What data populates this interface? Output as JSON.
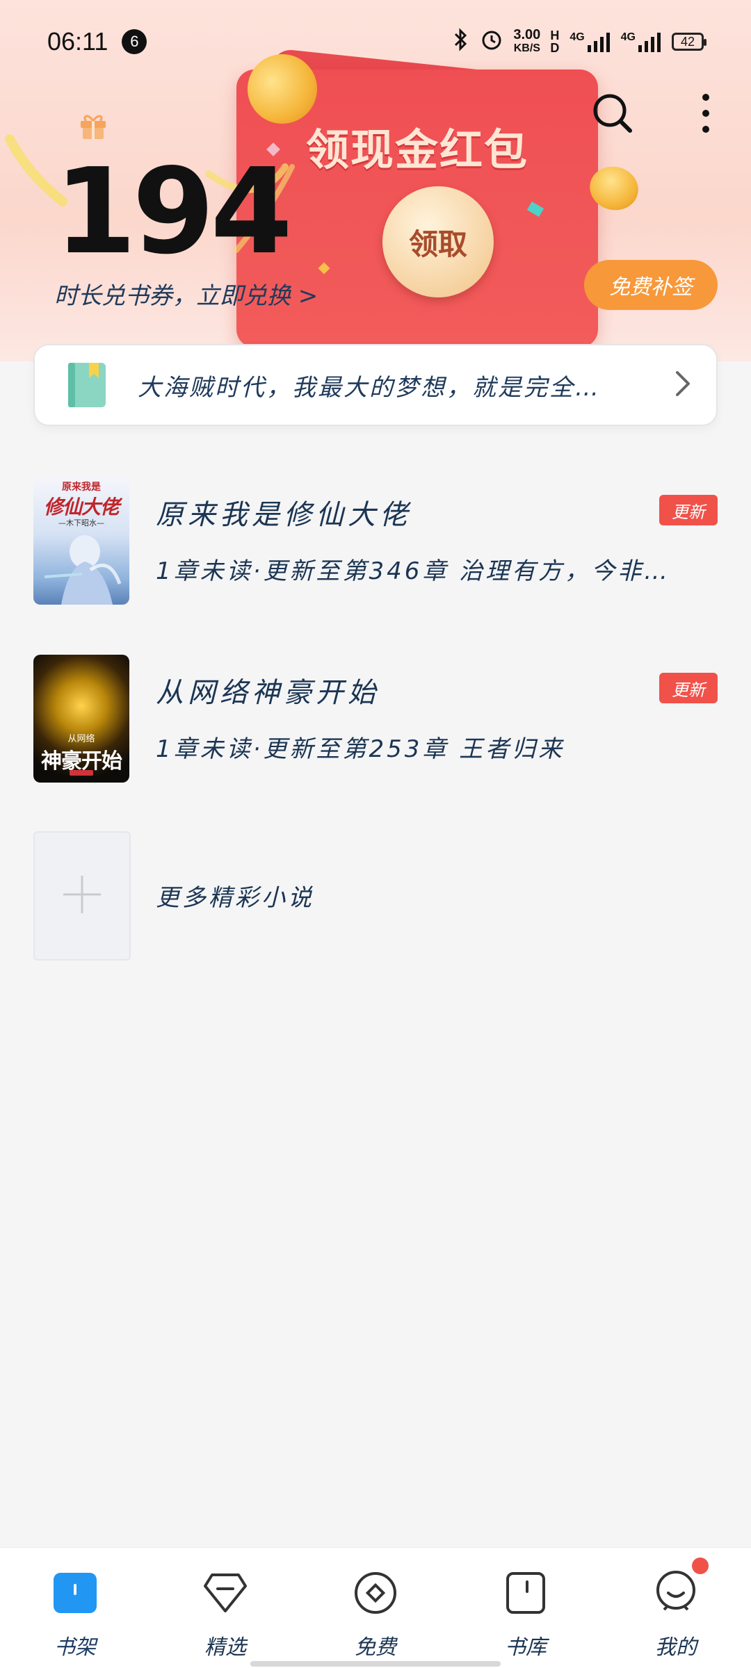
{
  "status_bar": {
    "time": "06:11",
    "notification_count": "6",
    "speed_value": "3.00",
    "speed_unit": "KB/S",
    "hd_label": "H D",
    "network_1": "4G",
    "network_2": "4G",
    "battery": "42"
  },
  "header": {
    "packet_title": "领现金红包",
    "claim_label": "领取",
    "duration_count": "194",
    "redeem_text": "时长兑书券，立即兑换 >",
    "free_sign_label": "免费补签"
  },
  "announcement": {
    "text": "大海贼时代，我最大的梦想，就是完全…"
  },
  "books": [
    {
      "title": "原来我是修仙大佬",
      "subtitle": "1章未读·更新至第346章 治理有方，今非…",
      "badge": "更新",
      "cover_title": "修仙大佬",
      "cover_top": "原来我是",
      "cover_author": "—木下昭水—"
    },
    {
      "title": "从网络神豪开始",
      "subtitle": "1章未读·更新至第253章 王者归来",
      "badge": "更新",
      "cover_title": "神豪开始",
      "cover_top": "从网络"
    }
  ],
  "more": {
    "label": "更多精彩小说"
  },
  "bottom_nav": [
    {
      "label": "书架",
      "icon": "bookshelf-icon",
      "active": true
    },
    {
      "label": "精选",
      "icon": "featured-icon",
      "active": false
    },
    {
      "label": "免费",
      "icon": "free-icon",
      "active": false
    },
    {
      "label": "书库",
      "icon": "library-icon",
      "active": false
    },
    {
      "label": "我的",
      "icon": "profile-icon",
      "active": false
    }
  ],
  "colors": {
    "accent_blue": "#2196f3",
    "badge_red": "#f0524a",
    "sign_orange": "#f7983a",
    "packet_red": "#ef4f53"
  }
}
